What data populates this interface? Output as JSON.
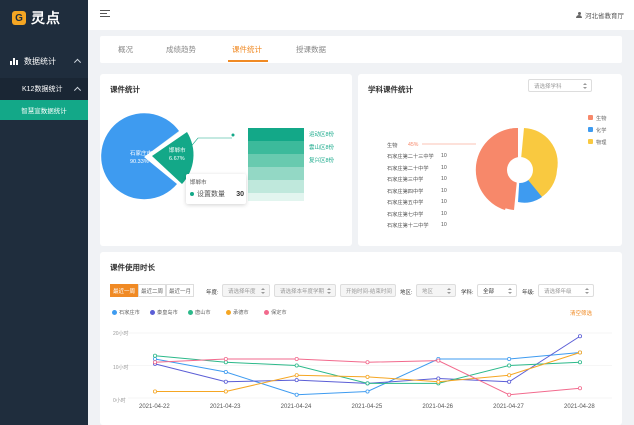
{
  "app": {
    "logo_mark": "G",
    "logo_text": "灵点"
  },
  "sidebar": {
    "group_label": "数据统计",
    "sub_label": "K12数据统计",
    "leaf_label": "智慧宣数据统计"
  },
  "header": {
    "user_label": "河北省教育厅"
  },
  "tabs": [
    "概况",
    "成绩趋势",
    "课件统计",
    "授课数据"
  ],
  "active_tab": 2,
  "courseware_card": {
    "title": "课件统计",
    "pie": {
      "label_big": "石家庄市",
      "pct_big": "90.33%",
      "label_small": "邯郸市",
      "pct_small": "6.67%"
    },
    "tooltip": {
      "city": "邯郸市",
      "metric": "设置数量",
      "value": "30"
    },
    "funnel_labels": [
      "运动区8份",
      "雲山区8份",
      "复兴区8份"
    ]
  },
  "subject_card": {
    "title": "学科课件统计",
    "select_placeholder": "请选择学科",
    "subject_row": {
      "label": "生物",
      "pct": "45%"
    },
    "schools": [
      {
        "name": "石家庄第二十三中学",
        "value": "10"
      },
      {
        "name": "石家庄第二十中学",
        "value": "10"
      },
      {
        "name": "石家庄第三中学",
        "value": "10"
      },
      {
        "name": "石家庄第四中学",
        "value": "10"
      },
      {
        "name": "石家庄第五中学",
        "value": "10"
      },
      {
        "name": "石家庄第七中学",
        "value": "10"
      },
      {
        "name": "石家庄第十二中学",
        "value": "10"
      }
    ],
    "legend": [
      {
        "name": "生物",
        "color": "#f7886a"
      },
      {
        "name": "化学",
        "color": "#3e9bf0"
      },
      {
        "name": "物理",
        "color": "#f9c940"
      }
    ]
  },
  "usage_card": {
    "title": "课件使用时长",
    "range_buttons": [
      "最近一周",
      "最近二周",
      "最近一月"
    ],
    "filters": {
      "year_label": "年度:",
      "year_placeholder": "请选择年度",
      "semester_placeholder": "请选择本年度学期",
      "date_placeholder": "开始时间-结束时间",
      "region_label": "地区:",
      "region_value": "地区",
      "subject_label": "学科:",
      "subject_value": "全部",
      "grade_label": "年级:",
      "grade_placeholder": "请选择年级"
    },
    "reset_label": "清空筛选",
    "y_ticks": [
      "20小时",
      "10小时",
      "0小时"
    ]
  },
  "chart_data": {
    "type": "line",
    "x": [
      "2021-04-22",
      "2021-04-23",
      "2021-04-24",
      "2021-04-25",
      "2021-04-26",
      "2021-04-27",
      "2021-04-28"
    ],
    "ylim": [
      0,
      20
    ],
    "series": [
      {
        "name": "石家庄市",
        "color": "#3e9bf0",
        "values": [
          12,
          8,
          1,
          2,
          12,
          12,
          14
        ]
      },
      {
        "name": "秦皇岛市",
        "color": "#5b5ed6",
        "values": [
          10.5,
          5,
          5.5,
          4.5,
          6,
          5,
          19
        ]
      },
      {
        "name": "唐山市",
        "color": "#2cb98a",
        "values": [
          13,
          11,
          10,
          4.5,
          4.5,
          10,
          11
        ]
      },
      {
        "name": "承德市",
        "color": "#f5a623",
        "values": [
          2,
          2,
          7,
          6.5,
          5,
          7,
          14
        ]
      },
      {
        "name": "保定市",
        "color": "#f26a8d",
        "values": [
          11,
          12,
          12,
          11,
          11.5,
          1,
          3
        ]
      }
    ]
  },
  "colors": {
    "accent": "#f08a24",
    "sidebar_bg": "#1f2d3d",
    "active_leaf": "#13a888"
  }
}
